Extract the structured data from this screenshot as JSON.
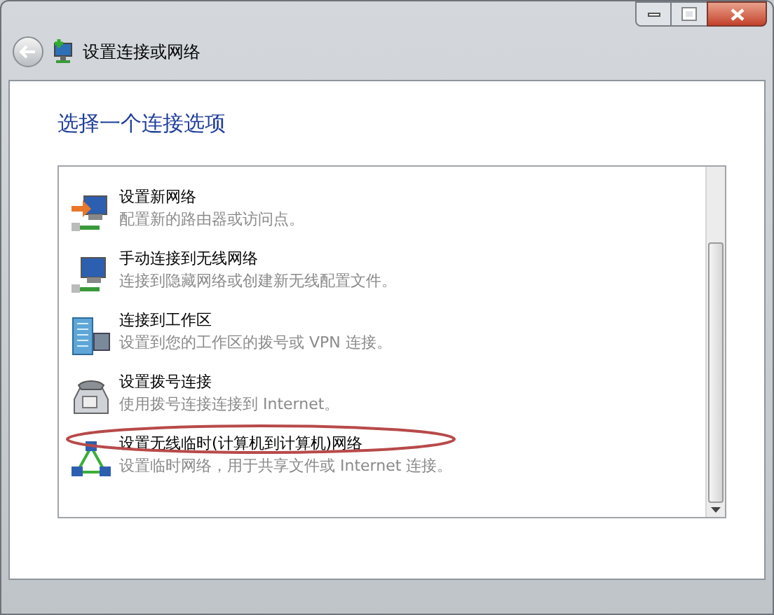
{
  "window": {
    "title": "设置连接或网络"
  },
  "heading": "选择一个连接选项",
  "options": [
    {
      "kind": "new-network",
      "title": "设置新网络",
      "description": "配置新的路由器或访问点。",
      "circled": false
    },
    {
      "kind": "wireless",
      "title": "手动连接到无线网络",
      "description": "连接到隐藏网络或创建新无线配置文件。",
      "circled": false
    },
    {
      "kind": "workplace",
      "title": "连接到工作区",
      "description": "设置到您的工作区的拨号或 VPN 连接。",
      "circled": false
    },
    {
      "kind": "dialup",
      "title": "设置拨号连接",
      "description": "使用拨号连接连接到 Internet。",
      "circled": false
    },
    {
      "kind": "adhoc",
      "title": "设置无线临时(计算机到计算机)网络",
      "description": "设置临时网络，用于共享文件或 Internet 连接。",
      "circled": true
    }
  ]
}
